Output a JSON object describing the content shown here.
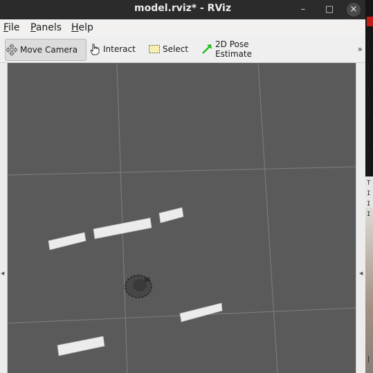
{
  "window": {
    "title": "model.rviz* - RViz"
  },
  "window_controls": {
    "minimize": "–",
    "maximize": "□",
    "close": "×"
  },
  "menu": {
    "items": [
      "File",
      "Panels",
      "Help"
    ]
  },
  "toolbar": {
    "move_camera": "Move Camera",
    "interact": "Interact",
    "select": "Select",
    "pose_estimate": "2D Pose Estimate",
    "overflow": "»"
  },
  "side_arrows": {
    "left": "◀",
    "right": "◀"
  },
  "background_glyphs": [
    "[",
    "[",
    "[",
    "[",
    "[",
    "F",
    "T",
    "I",
    "I",
    "I",
    "["
  ],
  "viewport": {
    "background": "#5a5a5a",
    "grid": true,
    "grid_color": "#7a7a7a",
    "obstacle_color": "#eeeeee"
  },
  "colors": {
    "titlebar": "#2b2b2b",
    "accent_green": "#1bbf1b"
  }
}
